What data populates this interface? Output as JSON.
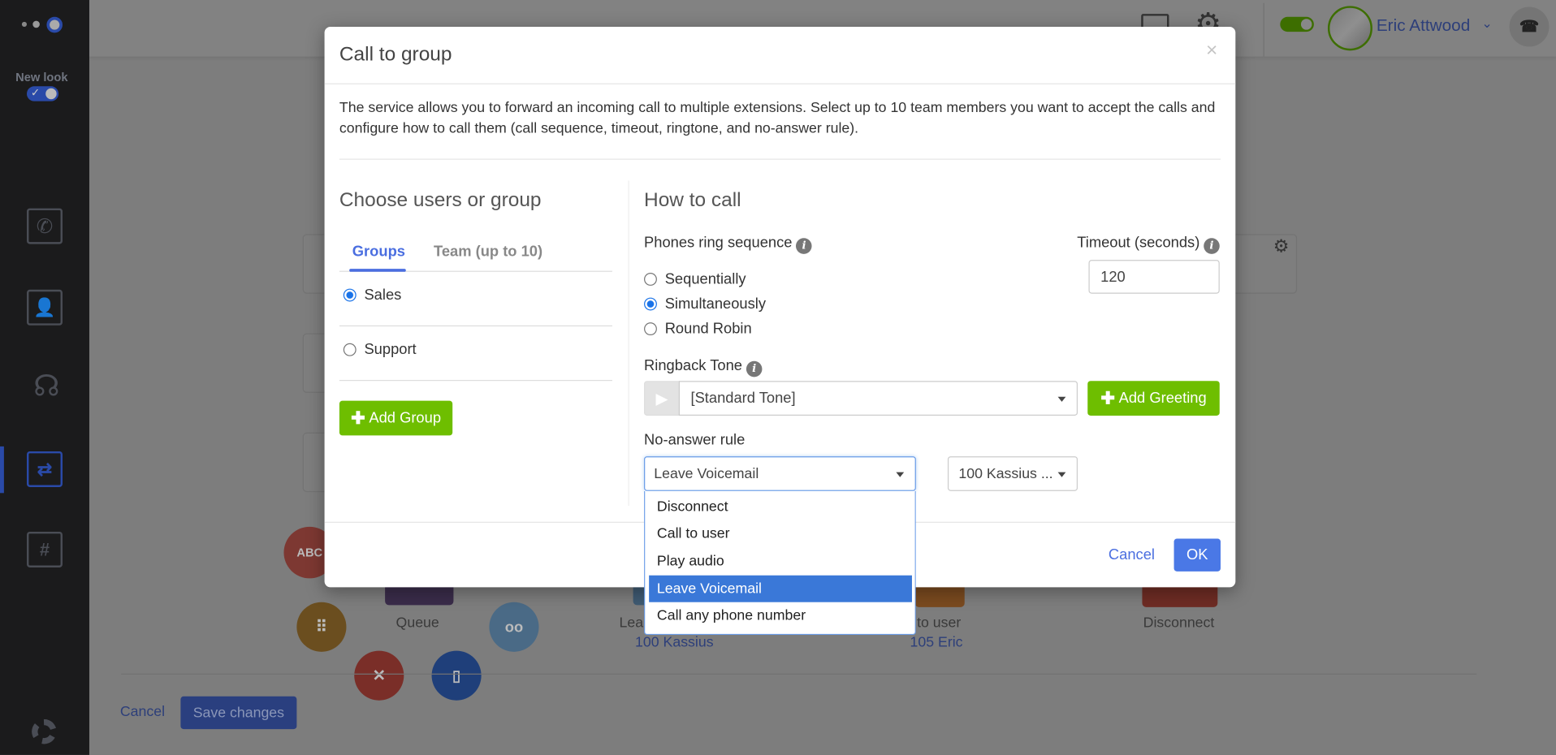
{
  "sidebar": {
    "new_look_label": "New look",
    "new_look_enabled": true,
    "items": [
      {
        "icon": "call-calendar-icon"
      },
      {
        "icon": "contacts-book-icon"
      },
      {
        "icon": "operator-headset-icon"
      },
      {
        "icon": "call-routing-icon",
        "active": true
      },
      {
        "icon": "phone-numbers-icon"
      }
    ],
    "help_icon": "lifebuoy-icon"
  },
  "header": {
    "user_name": "Eric Attwood",
    "status_enabled": true
  },
  "background": {
    "tiles": [
      {
        "label": "Queue",
        "sub": ""
      },
      {
        "label": "Lea",
        "sub": "100 Kassius"
      },
      {
        "label": "to user",
        "sub": "105 Eric"
      },
      {
        "label": "Disconnect",
        "sub": ""
      }
    ],
    "abc_label": "ABC",
    "cancel_label": "Cancel",
    "save_label": "Save changes"
  },
  "modal": {
    "title": "Call to group",
    "close_label": "×",
    "description": "The service allows you to forward an incoming call to multiple extensions. Select up to 10 team members you want to accept the calls and configure how to call them (call sequence, timeout, ringtone, and no-answer rule).",
    "left": {
      "heading": "Choose users or group",
      "tabs": [
        {
          "label": "Groups",
          "active": true
        },
        {
          "label": "Team (up to 10)",
          "active": false
        }
      ],
      "groups": [
        {
          "label": "Sales",
          "checked": true
        },
        {
          "label": "Support",
          "checked": false
        }
      ],
      "add_group_label": "Add Group"
    },
    "right": {
      "heading": "How to call",
      "ring_sequence_label": "Phones ring sequence",
      "ring_options": [
        {
          "label": "Sequentially",
          "checked": false
        },
        {
          "label": "Simultaneously",
          "checked": true
        },
        {
          "label": "Round Robin",
          "checked": false
        }
      ],
      "timeout_label": "Timeout (seconds)",
      "timeout_value": "120",
      "ringback_label": "Ringback Tone",
      "ringback_value": "[Standard Tone]",
      "add_greeting_label": "Add Greeting",
      "no_answer_label": "No-answer rule",
      "no_answer_value": "Leave Voicemail",
      "no_answer_target": "100 Kassius ...",
      "no_answer_options": [
        "Disconnect",
        "Call to user",
        "Play audio",
        "Leave Voicemail",
        "Call any phone number"
      ],
      "no_answer_selected": "Leave Voicemail"
    },
    "cancel_label": "Cancel",
    "ok_label": "OK"
  },
  "colors": {
    "accent": "#4a78e6",
    "green": "#6ebe00",
    "highlight": "#3a78d8"
  }
}
